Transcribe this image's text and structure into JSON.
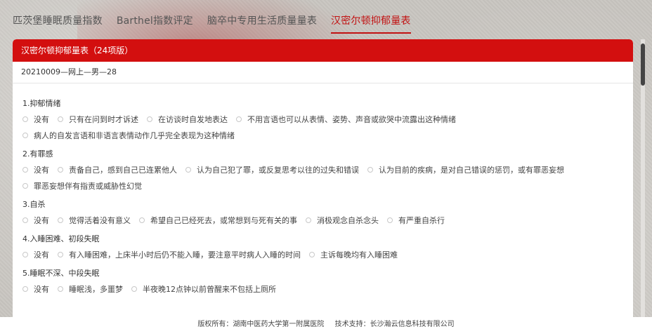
{
  "tabs": [
    {
      "label": "匹茨堡睡眠质量指数",
      "active": false
    },
    {
      "label": "Barthel指数评定",
      "active": false
    },
    {
      "label": "脑卒中专用生活质量量表",
      "active": false
    },
    {
      "label": "汉密尔顿抑郁量表",
      "active": true
    }
  ],
  "panel": {
    "title": "汉密尔顿抑郁量表（24项版）",
    "record_id": "20210009—网上—男—28"
  },
  "questions": [
    {
      "title": "1.抑郁情绪",
      "rows": [
        [
          "没有",
          "只有在问到时才诉述",
          "在访谈时自发地表达",
          "不用言语也可以从表情、姿势、声音或欲哭中流露出这种情绪"
        ],
        [
          "病人的自发言语和非语言表情动作几乎完全表现为这种情绪"
        ]
      ]
    },
    {
      "title": "2.有罪感",
      "rows": [
        [
          "没有",
          "责备自己，感到自己已连累他人",
          "认为自己犯了罪，或反复思考以往的过失和错误",
          "认为目前的疾病，是对自己错误的惩罚，或有罪恶妄想"
        ],
        [
          "罪恶妄想伴有指责或威胁性幻觉"
        ]
      ]
    },
    {
      "title": "3.自杀",
      "rows": [
        [
          "没有",
          "觉得活着没有意义",
          "希望自己已经死去，或常想到与死有关的事",
          "消极观念自杀念头",
          "有严重自杀行"
        ]
      ]
    },
    {
      "title": "4.入睡困难、初段失眠",
      "rows": [
        [
          "没有",
          "有入睡困难，上床半小时后仍不能入睡，要注意平时病人入睡的时间",
          "主诉每晚均有入睡困难"
        ]
      ]
    },
    {
      "title": "5.睡眠不深、中段失眠",
      "rows": [
        [
          "没有",
          "睡眠浅，多噩梦",
          "半夜晚12点钟以前曾醒来不包括上厕所"
        ]
      ]
    }
  ],
  "footer": {
    "copyright": "版权所有：湖南中医药大学第一附属医院",
    "support": "技术支持：长沙瀚云信息科技有限公司"
  },
  "colors": {
    "accent": "#d30f0f",
    "active_tab": "#c21212"
  }
}
